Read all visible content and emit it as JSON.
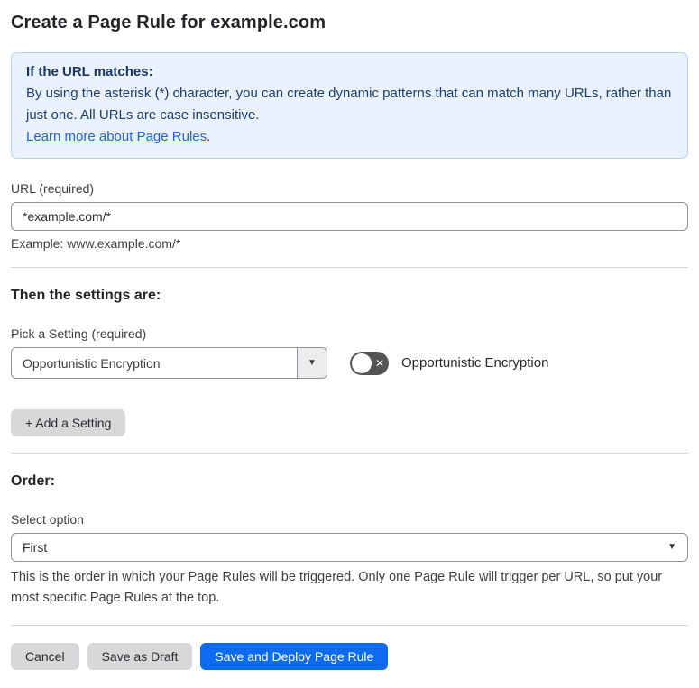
{
  "page": {
    "title": "Create a Page Rule for example.com"
  },
  "callout": {
    "heading": "If the URL matches:",
    "body": "By using the asterisk (*) character, you can create dynamic patterns that can match many URLs, rather than just one. All URLs are case insensitive.",
    "link_label": "Learn more about Page Rules",
    "link_suffix": "."
  },
  "url_field": {
    "label": "URL (required)",
    "value": "*example.com/*",
    "hint": "Example: www.example.com/*"
  },
  "settings": {
    "heading": "Then the settings are:",
    "picker_label": "Pick a Setting (required)",
    "picker_value": "Opportunistic Encryption",
    "toggle_label": "Opportunistic Encryption",
    "toggle_state": "off",
    "add_button_label": "+ Add a Setting"
  },
  "order": {
    "heading": "Order:",
    "select_label": "Select option",
    "select_value": "First",
    "help": "This is the order in which your Page Rules will be triggered. Only one Page Rule will trigger per URL, so put your most specific Page Rules at the top."
  },
  "actions": {
    "cancel_label": "Cancel",
    "save_draft_label": "Save as Draft",
    "save_deploy_label": "Save and Deploy Page Rule"
  },
  "icons": {
    "caret_down": "▼",
    "toggle_off": "✕"
  },
  "colors": {
    "primary_button": "#0d6bf2",
    "callout_bg": "#e9f2fc",
    "callout_border": "#b6d1f2",
    "callout_text": "#1e3c6e",
    "link": "#2563d3",
    "toggle_off": "#545456",
    "gray_button": "#d8d8da"
  }
}
